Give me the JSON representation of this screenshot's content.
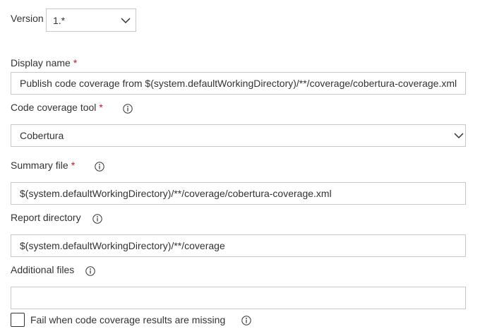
{
  "version": {
    "label": "Version",
    "value": "1.*"
  },
  "display_name": {
    "label": "Display name",
    "required_mark": "*",
    "value": "Publish code coverage from $(system.defaultWorkingDirectory)/**/coverage/cobertura-coverage.xml"
  },
  "code_coverage_tool": {
    "label": "Code coverage tool",
    "required_mark": "*",
    "value": "Cobertura",
    "icon": "info-icon"
  },
  "summary_file": {
    "label": "Summary file",
    "required_mark": "*",
    "value": "$(system.defaultWorkingDirectory)/**/coverage/cobertura-coverage.xml",
    "icon": "info-icon"
  },
  "report_directory": {
    "label": "Report directory",
    "value": "$(system.defaultWorkingDirectory)/**/coverage",
    "icon": "info-icon"
  },
  "additional_files": {
    "label": "Additional files",
    "value": "",
    "icon": "info-icon"
  },
  "fail_when_missing": {
    "label": "Fail when code coverage results are missing",
    "checked": false,
    "icon": "info-icon"
  },
  "colors": {
    "text": "#333333",
    "required": "#c8102e",
    "border": "#c8c8c8"
  }
}
